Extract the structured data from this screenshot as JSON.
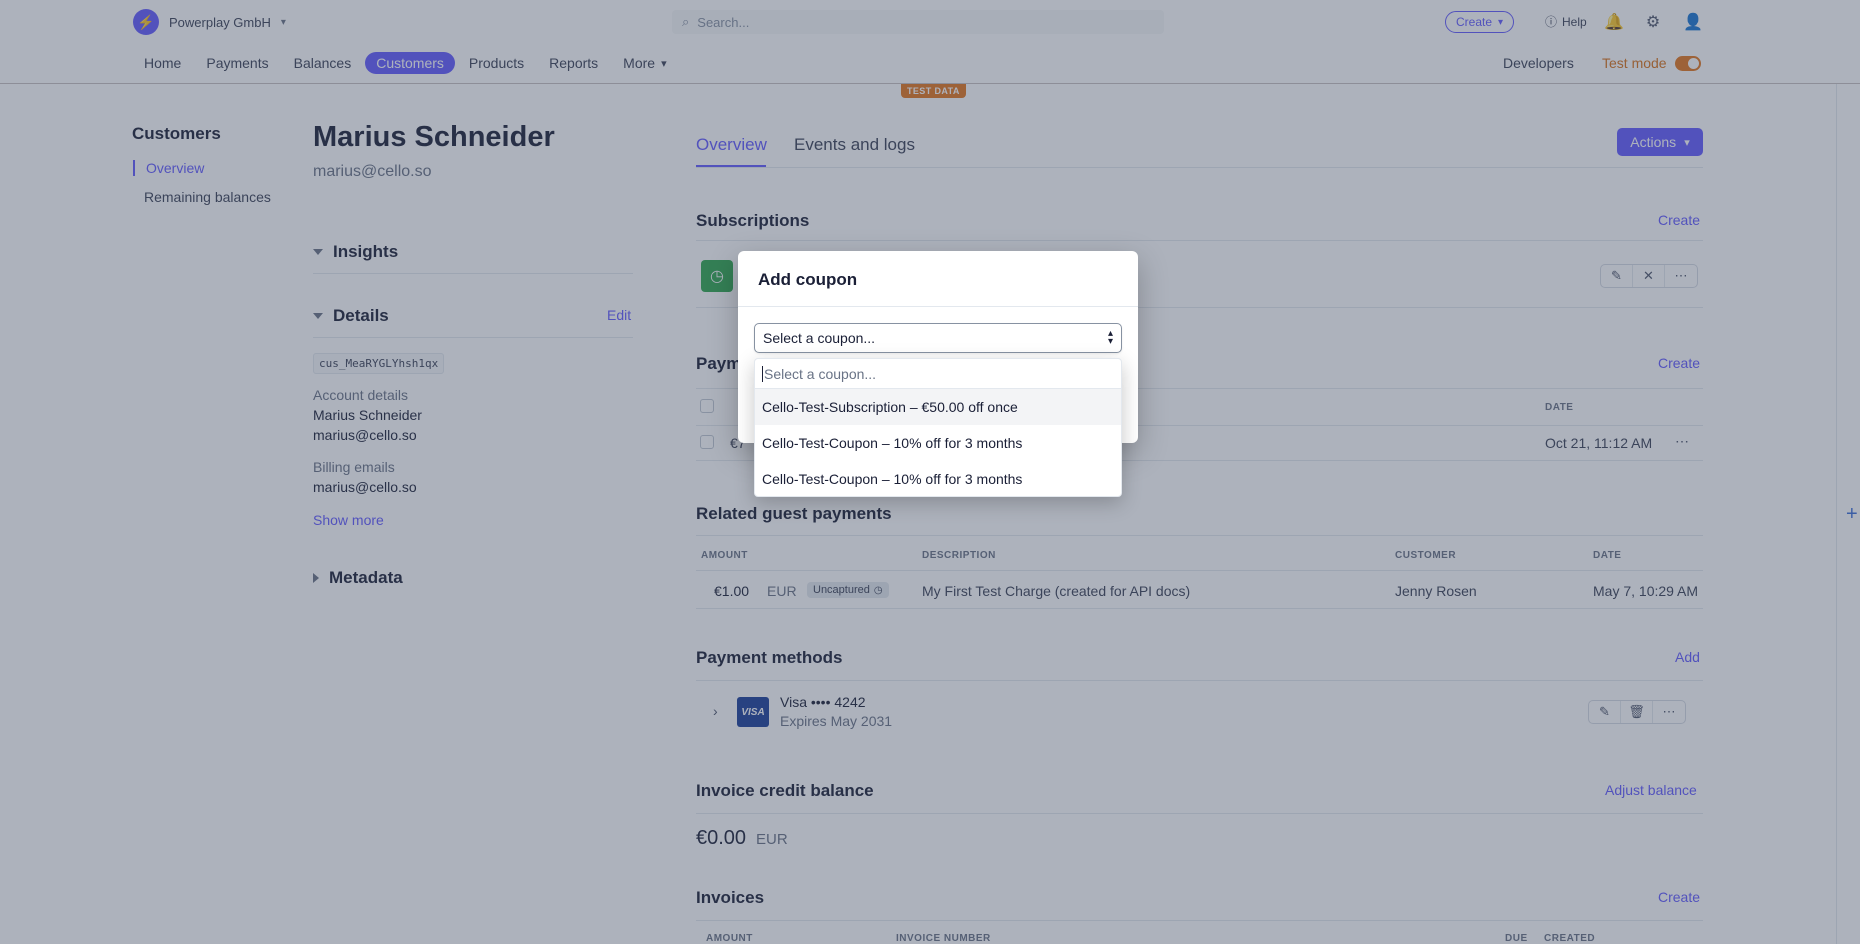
{
  "topbar": {
    "brand": "Powerplay GmbH",
    "search_placeholder": "Search...",
    "create_label": "Create",
    "help_label": "Help",
    "developers_label": "Developers",
    "test_mode_label": "Test mode",
    "test_data_label": "TEST DATA"
  },
  "nav": {
    "items": [
      "Home",
      "Payments",
      "Balances",
      "Customers",
      "Products",
      "Reports",
      "More"
    ],
    "active": "Customers"
  },
  "sidebar": {
    "title": "Customers",
    "items": [
      {
        "label": "Overview",
        "active": true
      },
      {
        "label": "Remaining balances",
        "active": false
      }
    ]
  },
  "customer": {
    "name": "Marius Schneider",
    "email": "marius@cello.so",
    "insights_label": "Insights",
    "details_label": "Details",
    "edit_label": "Edit",
    "id": "cus_MeaRYGLYhsh1qx",
    "account_details_label": "Account details",
    "account_name": "Marius Schneider",
    "account_email": "marius@cello.so",
    "billing_emails_label": "Billing emails",
    "billing_email": "marius@cello.so",
    "show_more_label": "Show more",
    "metadata_label": "Metadata"
  },
  "main": {
    "tabs": [
      "Overview",
      "Events and logs"
    ],
    "actions_label": "Actions",
    "subscriptions": {
      "title": "Subscriptions",
      "create_label": "Create"
    },
    "payments": {
      "title": "Payme",
      "create_label": "Create",
      "date_header": "DATE",
      "row_amount": "€7",
      "row_date": "Oct 21, 11:12 AM"
    },
    "guest_payments": {
      "title": "Related guest payments",
      "headers": [
        "AMOUNT",
        "DESCRIPTION",
        "CUSTOMER",
        "DATE"
      ],
      "rows": [
        {
          "amount": "€1.00",
          "currency": "EUR",
          "status": "Uncaptured",
          "description": "My First Test Charge (created for API docs)",
          "customer": "Jenny Rosen",
          "date": "May 7, 10:29 AM"
        }
      ]
    },
    "payment_methods": {
      "title": "Payment methods",
      "add_label": "Add",
      "card_brand": "VISA",
      "card_label": "Visa •••• 4242",
      "card_expiry": "Expires May 2031"
    },
    "credit_balance": {
      "title": "Invoice credit balance",
      "adjust_label": "Adjust balance",
      "amount": "€0.00",
      "currency": "EUR"
    },
    "invoices": {
      "title": "Invoices",
      "create_label": "Create",
      "headers": [
        "AMOUNT",
        "INVOICE NUMBER",
        "DUE",
        "CREATED"
      ]
    }
  },
  "dialog": {
    "title": "Add coupon",
    "select_placeholder": "Select a coupon...",
    "search_placeholder": "Select a coupon...",
    "options": [
      "Cello-Test-Subscription – €50.00 off once",
      "Cello-Test-Coupon – 10% off for 3 months",
      "Cello-Test-Coupon – 10% off for 3 months"
    ],
    "highlighted_index": 0
  },
  "colors": {
    "accent": "#635bff",
    "test_mode": "#e3761c",
    "overlay": "rgba(60,72,95,0.42)"
  }
}
